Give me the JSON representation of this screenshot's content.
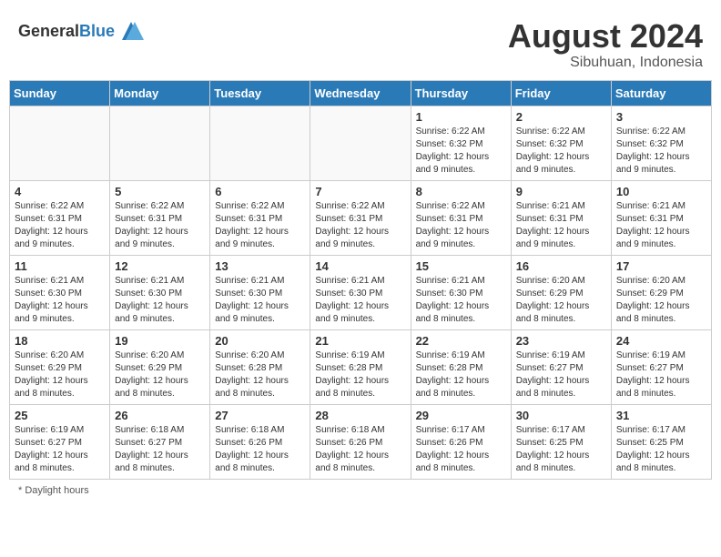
{
  "header": {
    "logo_general": "General",
    "logo_blue": "Blue",
    "month_year": "August 2024",
    "location": "Sibuhuan, Indonesia"
  },
  "days_of_week": [
    "Sunday",
    "Monday",
    "Tuesday",
    "Wednesday",
    "Thursday",
    "Friday",
    "Saturday"
  ],
  "footer": {
    "note": "Daylight hours"
  },
  "weeks": [
    [
      {
        "day": "",
        "empty": true
      },
      {
        "day": "",
        "empty": true
      },
      {
        "day": "",
        "empty": true
      },
      {
        "day": "",
        "empty": true
      },
      {
        "day": "1",
        "sunrise": "Sunrise: 6:22 AM",
        "sunset": "Sunset: 6:32 PM",
        "daylight": "Daylight: 12 hours and 9 minutes."
      },
      {
        "day": "2",
        "sunrise": "Sunrise: 6:22 AM",
        "sunset": "Sunset: 6:32 PM",
        "daylight": "Daylight: 12 hours and 9 minutes."
      },
      {
        "day": "3",
        "sunrise": "Sunrise: 6:22 AM",
        "sunset": "Sunset: 6:32 PM",
        "daylight": "Daylight: 12 hours and 9 minutes."
      }
    ],
    [
      {
        "day": "4",
        "sunrise": "Sunrise: 6:22 AM",
        "sunset": "Sunset: 6:31 PM",
        "daylight": "Daylight: 12 hours and 9 minutes."
      },
      {
        "day": "5",
        "sunrise": "Sunrise: 6:22 AM",
        "sunset": "Sunset: 6:31 PM",
        "daylight": "Daylight: 12 hours and 9 minutes."
      },
      {
        "day": "6",
        "sunrise": "Sunrise: 6:22 AM",
        "sunset": "Sunset: 6:31 PM",
        "daylight": "Daylight: 12 hours and 9 minutes."
      },
      {
        "day": "7",
        "sunrise": "Sunrise: 6:22 AM",
        "sunset": "Sunset: 6:31 PM",
        "daylight": "Daylight: 12 hours and 9 minutes."
      },
      {
        "day": "8",
        "sunrise": "Sunrise: 6:22 AM",
        "sunset": "Sunset: 6:31 PM",
        "daylight": "Daylight: 12 hours and 9 minutes."
      },
      {
        "day": "9",
        "sunrise": "Sunrise: 6:21 AM",
        "sunset": "Sunset: 6:31 PM",
        "daylight": "Daylight: 12 hours and 9 minutes."
      },
      {
        "day": "10",
        "sunrise": "Sunrise: 6:21 AM",
        "sunset": "Sunset: 6:31 PM",
        "daylight": "Daylight: 12 hours and 9 minutes."
      }
    ],
    [
      {
        "day": "11",
        "sunrise": "Sunrise: 6:21 AM",
        "sunset": "Sunset: 6:30 PM",
        "daylight": "Daylight: 12 hours and 9 minutes."
      },
      {
        "day": "12",
        "sunrise": "Sunrise: 6:21 AM",
        "sunset": "Sunset: 6:30 PM",
        "daylight": "Daylight: 12 hours and 9 minutes."
      },
      {
        "day": "13",
        "sunrise": "Sunrise: 6:21 AM",
        "sunset": "Sunset: 6:30 PM",
        "daylight": "Daylight: 12 hours and 9 minutes."
      },
      {
        "day": "14",
        "sunrise": "Sunrise: 6:21 AM",
        "sunset": "Sunset: 6:30 PM",
        "daylight": "Daylight: 12 hours and 9 minutes."
      },
      {
        "day": "15",
        "sunrise": "Sunrise: 6:21 AM",
        "sunset": "Sunset: 6:30 PM",
        "daylight": "Daylight: 12 hours and 8 minutes."
      },
      {
        "day": "16",
        "sunrise": "Sunrise: 6:20 AM",
        "sunset": "Sunset: 6:29 PM",
        "daylight": "Daylight: 12 hours and 8 minutes."
      },
      {
        "day": "17",
        "sunrise": "Sunrise: 6:20 AM",
        "sunset": "Sunset: 6:29 PM",
        "daylight": "Daylight: 12 hours and 8 minutes."
      }
    ],
    [
      {
        "day": "18",
        "sunrise": "Sunrise: 6:20 AM",
        "sunset": "Sunset: 6:29 PM",
        "daylight": "Daylight: 12 hours and 8 minutes."
      },
      {
        "day": "19",
        "sunrise": "Sunrise: 6:20 AM",
        "sunset": "Sunset: 6:29 PM",
        "daylight": "Daylight: 12 hours and 8 minutes."
      },
      {
        "day": "20",
        "sunrise": "Sunrise: 6:20 AM",
        "sunset": "Sunset: 6:28 PM",
        "daylight": "Daylight: 12 hours and 8 minutes."
      },
      {
        "day": "21",
        "sunrise": "Sunrise: 6:19 AM",
        "sunset": "Sunset: 6:28 PM",
        "daylight": "Daylight: 12 hours and 8 minutes."
      },
      {
        "day": "22",
        "sunrise": "Sunrise: 6:19 AM",
        "sunset": "Sunset: 6:28 PM",
        "daylight": "Daylight: 12 hours and 8 minutes."
      },
      {
        "day": "23",
        "sunrise": "Sunrise: 6:19 AM",
        "sunset": "Sunset: 6:27 PM",
        "daylight": "Daylight: 12 hours and 8 minutes."
      },
      {
        "day": "24",
        "sunrise": "Sunrise: 6:19 AM",
        "sunset": "Sunset: 6:27 PM",
        "daylight": "Daylight: 12 hours and 8 minutes."
      }
    ],
    [
      {
        "day": "25",
        "sunrise": "Sunrise: 6:19 AM",
        "sunset": "Sunset: 6:27 PM",
        "daylight": "Daylight: 12 hours and 8 minutes."
      },
      {
        "day": "26",
        "sunrise": "Sunrise: 6:18 AM",
        "sunset": "Sunset: 6:27 PM",
        "daylight": "Daylight: 12 hours and 8 minutes."
      },
      {
        "day": "27",
        "sunrise": "Sunrise: 6:18 AM",
        "sunset": "Sunset: 6:26 PM",
        "daylight": "Daylight: 12 hours and 8 minutes."
      },
      {
        "day": "28",
        "sunrise": "Sunrise: 6:18 AM",
        "sunset": "Sunset: 6:26 PM",
        "daylight": "Daylight: 12 hours and 8 minutes."
      },
      {
        "day": "29",
        "sunrise": "Sunrise: 6:17 AM",
        "sunset": "Sunset: 6:26 PM",
        "daylight": "Daylight: 12 hours and 8 minutes."
      },
      {
        "day": "30",
        "sunrise": "Sunrise: 6:17 AM",
        "sunset": "Sunset: 6:25 PM",
        "daylight": "Daylight: 12 hours and 8 minutes."
      },
      {
        "day": "31",
        "sunrise": "Sunrise: 6:17 AM",
        "sunset": "Sunset: 6:25 PM",
        "daylight": "Daylight: 12 hours and 8 minutes."
      }
    ]
  ]
}
